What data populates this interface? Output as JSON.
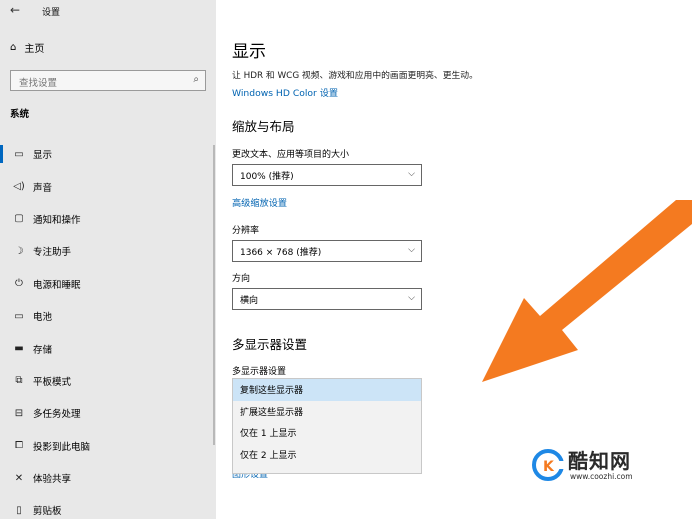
{
  "app": {
    "title": "设置",
    "back_icon": "arrow-left-icon"
  },
  "sidebar": {
    "home_label": "主页",
    "search_placeholder": "查找设置",
    "section": "系统",
    "items": [
      {
        "label": "显示",
        "icon": "monitor-icon",
        "active": true
      },
      {
        "label": "声音",
        "icon": "speaker-icon"
      },
      {
        "label": "通知和操作",
        "icon": "notification-icon"
      },
      {
        "label": "专注助手",
        "icon": "moon-icon"
      },
      {
        "label": "电源和睡眠",
        "icon": "power-icon"
      },
      {
        "label": "电池",
        "icon": "battery-icon"
      },
      {
        "label": "存储",
        "icon": "storage-icon"
      },
      {
        "label": "平板模式",
        "icon": "tablet-icon"
      },
      {
        "label": "多任务处理",
        "icon": "multitask-icon"
      },
      {
        "label": "投影到此电脑",
        "icon": "project-icon"
      },
      {
        "label": "体验共享",
        "icon": "share-icon"
      },
      {
        "label": "剪贴板",
        "icon": "clipboard-icon"
      }
    ]
  },
  "main": {
    "title": "显示",
    "description": "让 HDR 和 WCG 视频、游戏和应用中的画面更明亮、更生动。",
    "hd_color_link": "Windows HD Color 设置",
    "scale_heading": "缩放与布局",
    "scale_label": "更改文本、应用等项目的大小",
    "scale_value": "100% (推荐)",
    "advanced_scale_link": "高级缩放设置",
    "resolution_label": "分辨率",
    "resolution_value": "1366 × 768 (推荐)",
    "orientation_label": "方向",
    "orientation_value": "横向",
    "multi_heading": "多显示器设置",
    "multi_label": "多显示器设置",
    "multi_options": [
      "复制这些显示器",
      "扩展这些显示器",
      "仅在 1 上显示",
      "仅在 2 上显示"
    ],
    "partial_link": "图形设置"
  },
  "watermark": {
    "name": "酷知网",
    "url": "www.coozhi.com"
  },
  "colors": {
    "accent": "#0067c0",
    "link": "#0063b1",
    "arrow": "#f47a20",
    "selected": "#cce4f7"
  }
}
